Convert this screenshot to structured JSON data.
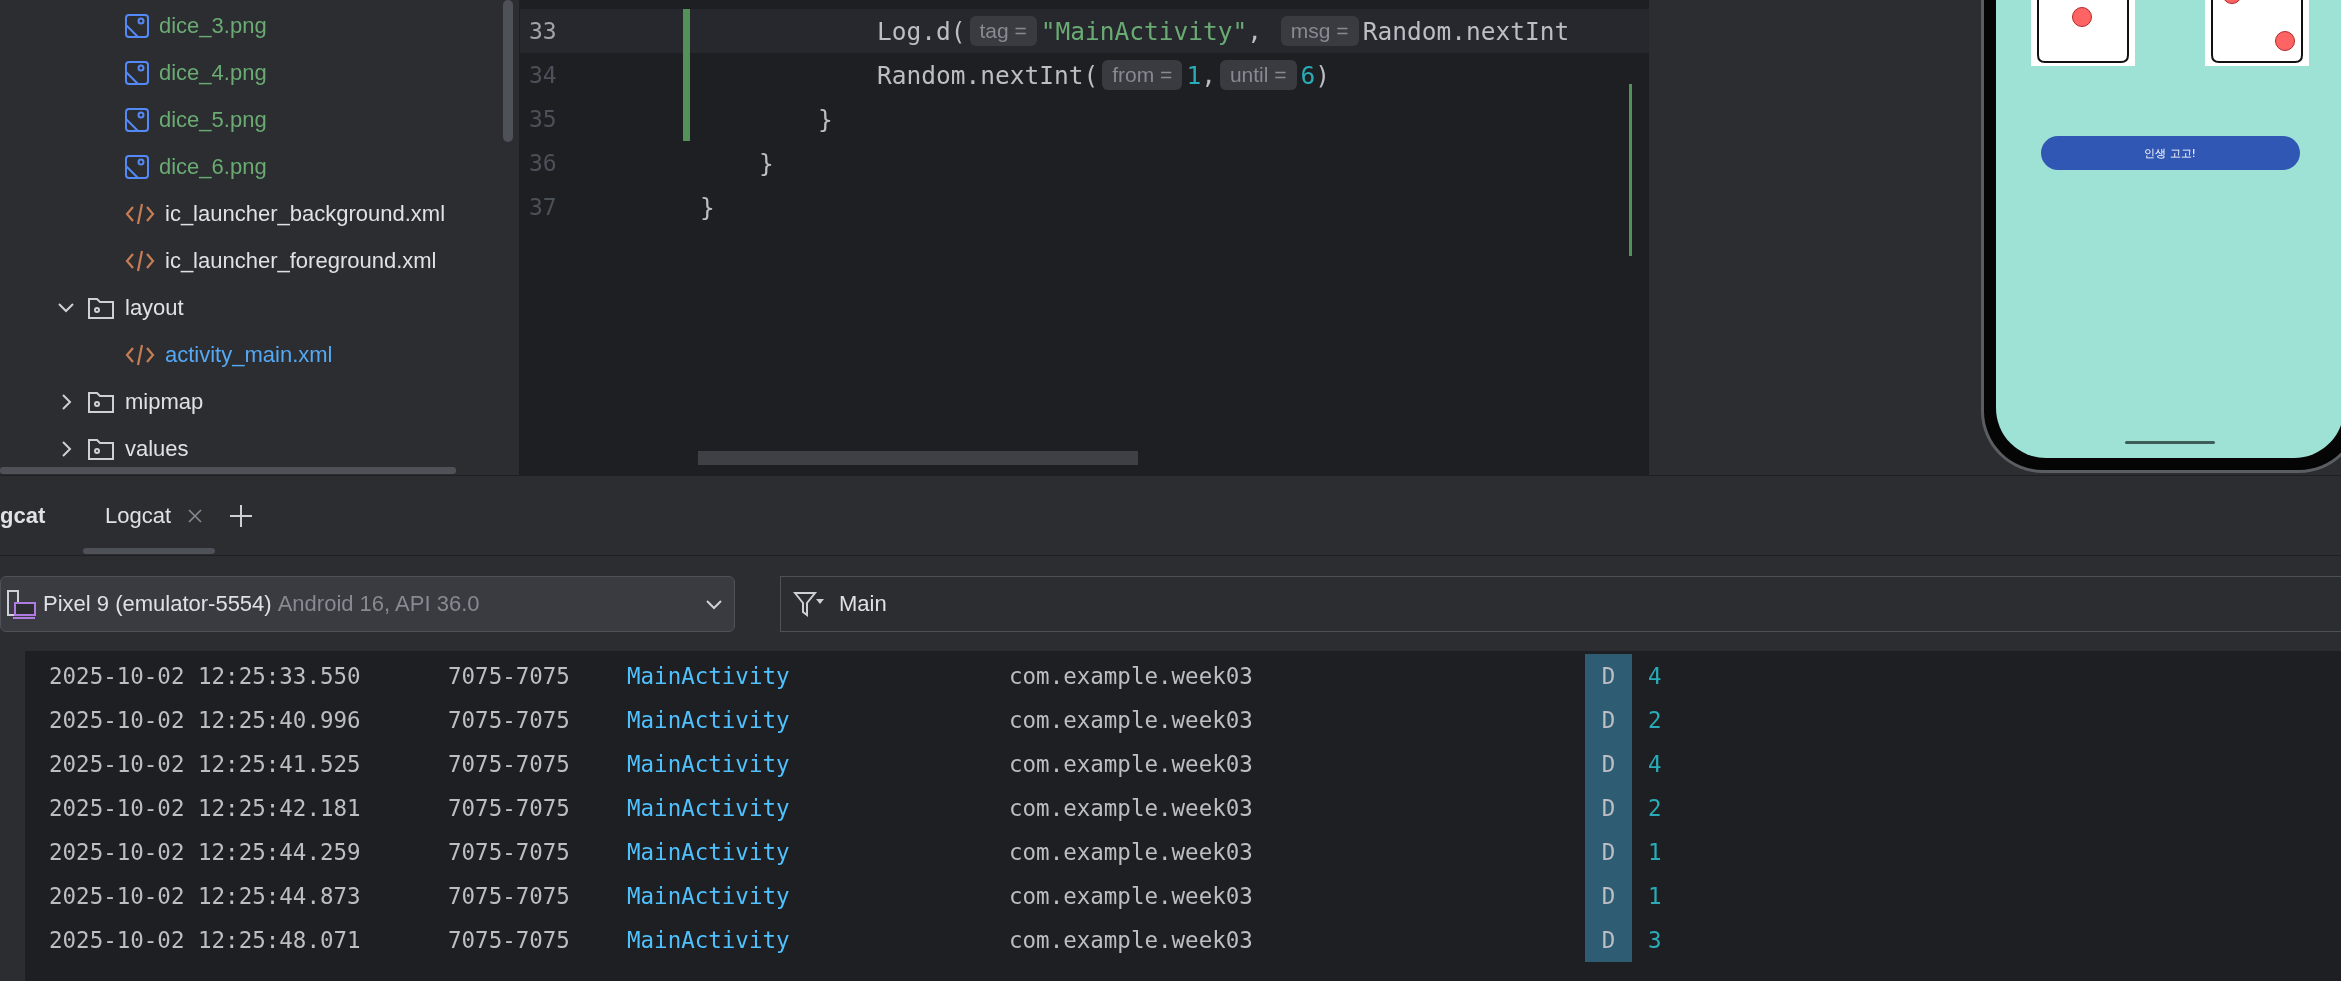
{
  "project_tree": [
    {
      "kind": "image",
      "name": "dice_3.png",
      "color": "#6aab73"
    },
    {
      "kind": "image",
      "name": "dice_4.png",
      "color": "#6aab73"
    },
    {
      "kind": "image",
      "name": "dice_5.png",
      "color": "#6aab73"
    },
    {
      "kind": "image",
      "name": "dice_6.png",
      "color": "#6aab73"
    },
    {
      "kind": "xml",
      "name": "ic_launcher_background.xml",
      "color": "#dfe1e5"
    },
    {
      "kind": "xml",
      "name": "ic_launcher_foreground.xml",
      "color": "#dfe1e5"
    },
    {
      "kind": "folder",
      "name": "layout",
      "expanded": true,
      "children": [
        {
          "kind": "xml",
          "name": "activity_main.xml",
          "color": "#56a8f5"
        }
      ]
    },
    {
      "kind": "folder",
      "name": "mipmap",
      "expanded": false
    },
    {
      "kind": "folder",
      "name": "values",
      "expanded": false
    }
  ],
  "editor": {
    "lines": [
      {
        "number": "33",
        "current": true,
        "changed": true,
        "segments": [
          {
            "kind": "code",
            "text": "            Log.d("
          },
          {
            "kind": "hint",
            "text": "tag ="
          },
          {
            "kind": "string",
            "text": "\"MainActivity\""
          },
          {
            "kind": "code",
            "text": ", "
          },
          {
            "kind": "hint",
            "text": "msg ="
          },
          {
            "kind": "code",
            "text": "Random.nextInt"
          }
        ]
      },
      {
        "number": "34",
        "current": false,
        "changed": true,
        "segments": [
          {
            "kind": "code",
            "text": "            Random.nextInt("
          },
          {
            "kind": "hint",
            "text": "from ="
          },
          {
            "kind": "number",
            "text": "1"
          },
          {
            "kind": "code",
            "text": ","
          },
          {
            "kind": "hint",
            "text": "until ="
          },
          {
            "kind": "number",
            "text": "6"
          },
          {
            "kind": "code",
            "text": ")"
          }
        ]
      },
      {
        "number": "35",
        "current": false,
        "changed": true,
        "segments": [
          {
            "kind": "code",
            "text": "        }"
          }
        ]
      },
      {
        "number": "36",
        "current": false,
        "changed": false,
        "segments": [
          {
            "kind": "code",
            "text": "    }"
          }
        ]
      },
      {
        "number": "37",
        "current": false,
        "changed": false,
        "segments": [
          {
            "kind": "code",
            "text": "}"
          }
        ]
      }
    ]
  },
  "emulator": {
    "button": "인생 고고!"
  },
  "logcat": {
    "title": "gcat",
    "tabs": [
      {
        "label": "Logcat",
        "selected": true
      }
    ],
    "device": {
      "name": "Pixel 9 (emulator-5554)",
      "detail": "Android 16, API 36.0"
    },
    "filter": "Main",
    "rows": [
      {
        "time": "2025-10-02 12:25:33.550",
        "pid": "7075-7075",
        "tag": "MainActivity",
        "package": "com.example.week03",
        "level": "D",
        "message": "4"
      },
      {
        "time": "2025-10-02 12:25:40.996",
        "pid": "7075-7075",
        "tag": "MainActivity",
        "package": "com.example.week03",
        "level": "D",
        "message": "2"
      },
      {
        "time": "2025-10-02 12:25:41.525",
        "pid": "7075-7075",
        "tag": "MainActivity",
        "package": "com.example.week03",
        "level": "D",
        "message": "4"
      },
      {
        "time": "2025-10-02 12:25:42.181",
        "pid": "7075-7075",
        "tag": "MainActivity",
        "package": "com.example.week03",
        "level": "D",
        "message": "2"
      },
      {
        "time": "2025-10-02 12:25:44.259",
        "pid": "7075-7075",
        "tag": "MainActivity",
        "package": "com.example.week03",
        "level": "D",
        "message": "1"
      },
      {
        "time": "2025-10-02 12:25:44.873",
        "pid": "7075-7075",
        "tag": "MainActivity",
        "package": "com.example.week03",
        "level": "D",
        "message": "1"
      },
      {
        "time": "2025-10-02 12:25:48.071",
        "pid": "7075-7075",
        "tag": "MainActivity",
        "package": "com.example.week03",
        "level": "D",
        "message": "3"
      }
    ]
  }
}
